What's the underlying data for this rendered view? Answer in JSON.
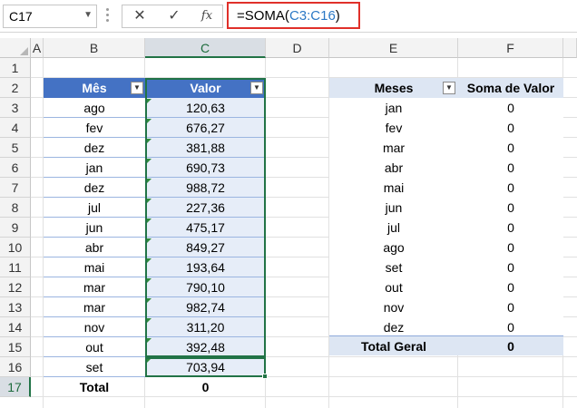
{
  "formula_bar": {
    "name_box": "C17",
    "formula_prefix": "=SOMA(",
    "formula_ref": "C3:C16",
    "formula_suffix": ")",
    "fx_label": "fx"
  },
  "columns": [
    "A",
    "B",
    "C",
    "D",
    "E",
    "F"
  ],
  "rows": [
    "1",
    "2",
    "3",
    "4",
    "5",
    "6",
    "7",
    "8",
    "9",
    "10",
    "11",
    "12",
    "13",
    "14",
    "15",
    "16",
    "17"
  ],
  "table": {
    "headers": [
      "Mês",
      "Valor"
    ],
    "rows": [
      {
        "mes": "ago",
        "valor": "120,63"
      },
      {
        "mes": "fev",
        "valor": "676,27"
      },
      {
        "mes": "dez",
        "valor": "381,88"
      },
      {
        "mes": "jan",
        "valor": "690,73"
      },
      {
        "mes": "dez",
        "valor": "988,72"
      },
      {
        "mes": "jul",
        "valor": "227,36"
      },
      {
        "mes": "jun",
        "valor": "475,17"
      },
      {
        "mes": "abr",
        "valor": "849,27"
      },
      {
        "mes": "mai",
        "valor": "193,64"
      },
      {
        "mes": "mar",
        "valor": "790,10"
      },
      {
        "mes": "mar",
        "valor": "982,74"
      },
      {
        "mes": "nov",
        "valor": "311,20"
      },
      {
        "mes": "out",
        "valor": "392,48"
      },
      {
        "mes": "set",
        "valor": "703,94"
      }
    ],
    "total_label": "Total",
    "total_value": "0"
  },
  "pivot": {
    "headers": [
      "Meses",
      "Soma de Valor"
    ],
    "rows": [
      {
        "mes": "jan",
        "soma": "0"
      },
      {
        "mes": "fev",
        "soma": "0"
      },
      {
        "mes": "mar",
        "soma": "0"
      },
      {
        "mes": "abr",
        "soma": "0"
      },
      {
        "mes": "mai",
        "soma": "0"
      },
      {
        "mes": "jun",
        "soma": "0"
      },
      {
        "mes": "jul",
        "soma": "0"
      },
      {
        "mes": "ago",
        "soma": "0"
      },
      {
        "mes": "set",
        "soma": "0"
      },
      {
        "mes": "out",
        "soma": "0"
      },
      {
        "mes": "nov",
        "soma": "0"
      },
      {
        "mes": "dez",
        "soma": "0"
      }
    ],
    "total_label": "Total Geral",
    "total_value": "0"
  },
  "colors": {
    "accent_green": "#217346",
    "table_header_blue": "#4472c4",
    "formula_highlight": "#e0302a",
    "range_ref": "#2b78c5"
  }
}
